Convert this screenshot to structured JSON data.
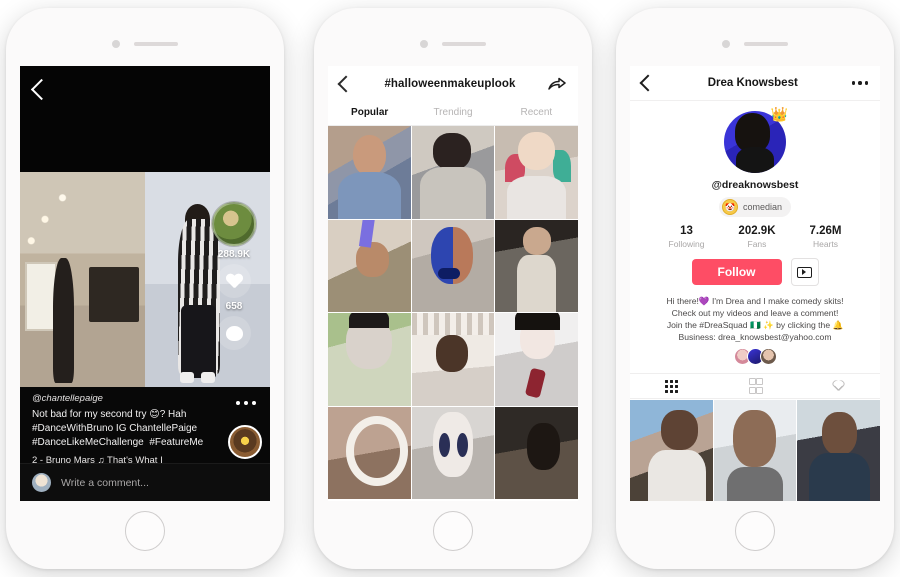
{
  "phone1": {
    "name": "tiktok-video-screen",
    "back_icon": "chevron-left-icon",
    "stats": {
      "likes": "288.9K",
      "comments": "658",
      "like_icon": "heart-icon",
      "comment_icon": "speech-bubble-icon",
      "music_disc_icon": "music-disc-icon"
    },
    "caption": {
      "username": "@chantellepaige",
      "line1": "Not bad for my second try 😊? Hah",
      "line2_tag": "#DanceWithBruno",
      "line2_rest": " IG ChantellePaige",
      "line3_tag1": "#DanceLikeMeChallenge",
      "line3_tag2": "#FeatureMe",
      "music": "2 - Bruno Mars   ♫  That's What I",
      "more_icon": "three-dots-icon",
      "author_avatar": "author-avatar"
    },
    "comment_bar": {
      "placeholder": "Write a comment...",
      "avatar": "user-avatar"
    }
  },
  "phone2": {
    "name": "hashtag-discover-screen",
    "header": {
      "title": "#halloweenmakeuplook",
      "back_icon": "chevron-left-icon",
      "share_icon": "share-arrow-icon"
    },
    "tabs": [
      {
        "label": "Popular",
        "active": true
      },
      {
        "label": "Trending",
        "active": false
      },
      {
        "label": "Recent",
        "active": false
      }
    ],
    "grid_cells": [
      {
        "name": "thumb-clown-makeup"
      },
      {
        "name": "thumb-prosthetic-nose"
      },
      {
        "name": "thumb-harley-quinn"
      },
      {
        "name": "thumb-face-paint-brush"
      },
      {
        "name": "thumb-blue-half-face"
      },
      {
        "name": "thumb-corpse-bride"
      },
      {
        "name": "thumb-silver-skull"
      },
      {
        "name": "thumb-white-dress-rack"
      },
      {
        "name": "thumb-goth-lipstick"
      },
      {
        "name": "thumb-white-eye-circle"
      },
      {
        "name": "thumb-skull-face-paint"
      },
      {
        "name": "thumb-dark-room"
      }
    ]
  },
  "phone3": {
    "name": "tiktok-profile-screen",
    "header": {
      "title": "Drea Knowsbest",
      "back_icon": "chevron-left-icon",
      "more_icon": "three-dots-icon"
    },
    "profile": {
      "avatar": "profile-avatar",
      "crown_icon": "crown-icon",
      "handle": "@dreaknowsbest",
      "badge_label": "comedian",
      "badge_icon": "verified-comedian-icon"
    },
    "stats": [
      {
        "value": "13",
        "label": "Following"
      },
      {
        "value": "202.9K",
        "label": "Fans"
      },
      {
        "value": "7.26M",
        "label": "Hearts"
      }
    ],
    "follow_button": "Follow",
    "youtube_button_icon": "play-box-icon",
    "bio": {
      "line1": "Hi there!💜 I'm Drea and I make comedy skits!",
      "line2": "Check out my videos and leave a comment!",
      "line3": "Join the #DreaSquad 🇳🇬 ✨ by clicking the 🔔",
      "line4": "Business: drea_knowsbest@yahoo.com"
    },
    "content_tabs": [
      {
        "name": "tab-videos-grid",
        "icon": "grid-dots-icon",
        "active": true
      },
      {
        "name": "tab-liked-squares",
        "icon": "four-squares-icon",
        "active": false
      },
      {
        "name": "tab-hearts",
        "icon": "heart-outline-icon",
        "active": false
      }
    ],
    "videos": [
      {
        "name": "video-thumb-1"
      },
      {
        "name": "video-thumb-2"
      },
      {
        "name": "video-thumb-3"
      }
    ]
  },
  "colors": {
    "accent_follow": "#fe4d65",
    "badge_gold": "#f7c948",
    "phone_body": "#fbfafa",
    "text_dark": "#161616",
    "text_muted": "#b6b4b4"
  }
}
